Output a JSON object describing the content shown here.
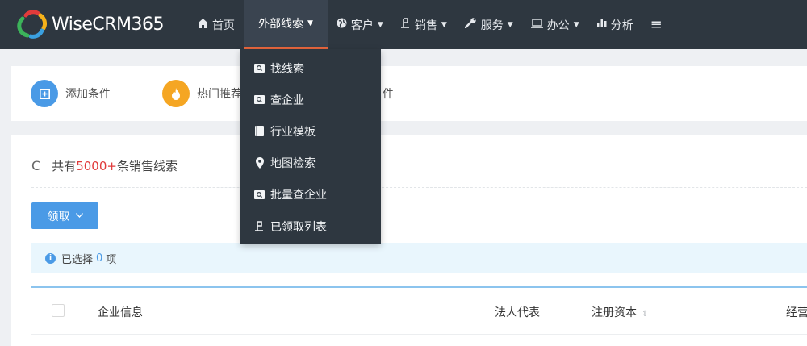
{
  "app": {
    "name": "WiseCRM365"
  },
  "nav": {
    "items": [
      {
        "icon": "home-icon",
        "label": "首页"
      },
      {
        "icon": "",
        "label": "外部线索",
        "active": true
      },
      {
        "icon": "globe-icon",
        "label": "客户"
      },
      {
        "icon": "flag-icon",
        "label": "销售"
      },
      {
        "icon": "wrench-icon",
        "label": "服务"
      },
      {
        "icon": "laptop-icon",
        "label": "办公"
      },
      {
        "icon": "bar-chart-icon",
        "label": "分析"
      }
    ],
    "menu_icon": "hamburger-menu-icon"
  },
  "dropdown": {
    "items": [
      {
        "icon": "search-card-icon",
        "label": "找线索"
      },
      {
        "icon": "search-card-icon",
        "label": "查企业"
      },
      {
        "icon": "book-icon",
        "label": "行业模板"
      },
      {
        "icon": "map-pin-icon",
        "label": "地图检索"
      },
      {
        "icon": "search-card-icon",
        "label": "批量查企业"
      },
      {
        "icon": "flag-icon",
        "label": "已领取列表"
      }
    ]
  },
  "filters": {
    "add_condition": "添加条件",
    "hot_recommend": "热门推荐",
    "partial_label": "件",
    "colors": {
      "add": "#4a9ae6",
      "hot": "#f5a623"
    }
  },
  "summary": {
    "prefix": "共有",
    "count": "5000+",
    "suffix": "条销售线索"
  },
  "claim_button": {
    "label": "领取"
  },
  "selection": {
    "prefix": "已选择",
    "count": "0",
    "suffix": "项"
  },
  "table": {
    "columns": [
      "企业信息",
      "法人代表",
      "注册资本",
      "经营"
    ]
  },
  "colors": {
    "nav_bg": "#2e3740",
    "accent_orange": "#e8663d",
    "primary_blue": "#4a9ae6",
    "count_red": "#e03a3a"
  }
}
